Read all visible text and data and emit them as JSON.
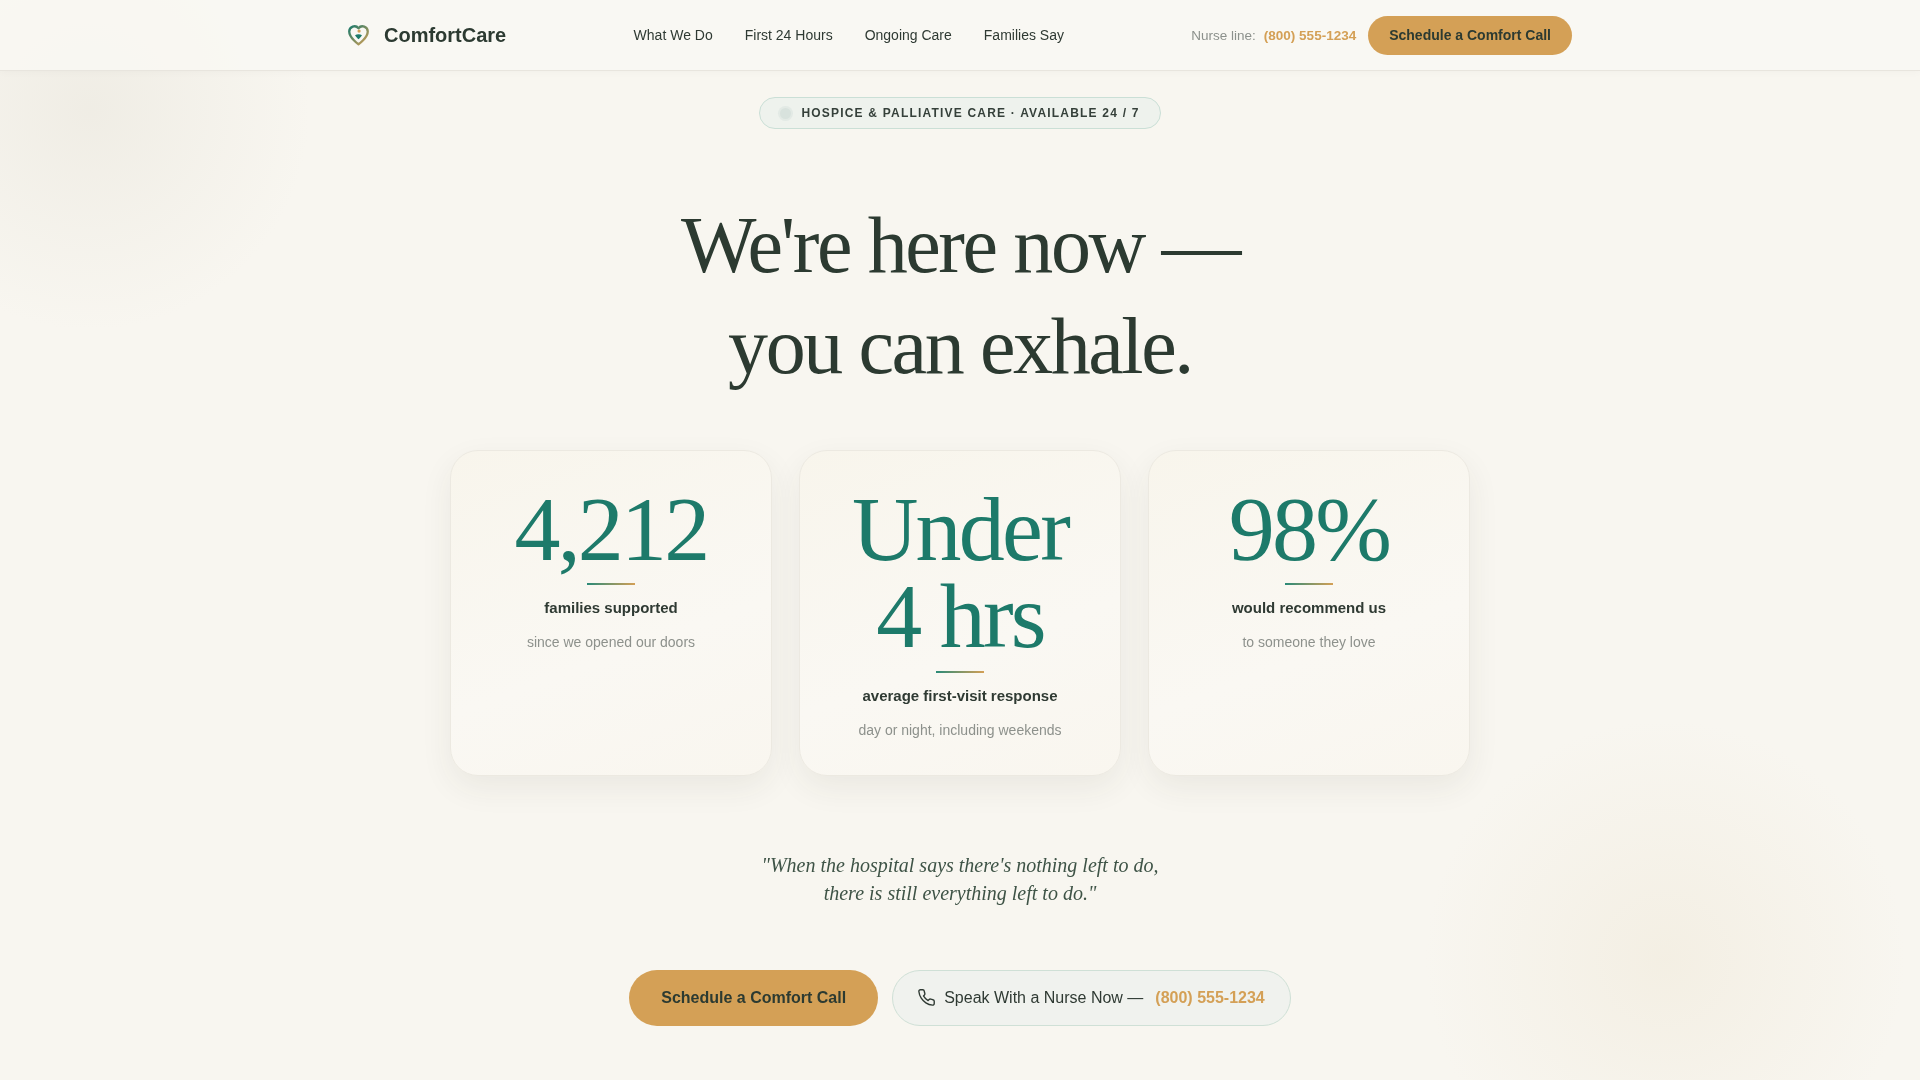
{
  "header": {
    "brand": "ComfortCare",
    "nav": [
      "What We Do",
      "First 24 Hours",
      "Ongoing Care",
      "Families Say"
    ],
    "nurse_line": {
      "label": "Nurse line:",
      "phone": "(800) 555-1234"
    },
    "button": "Schedule a Comfort Call"
  },
  "badge": "HOSPICE & PALLIATIVE CARE · AVAILABLE 24 / 7",
  "headline": "We're here now — you can exhale.",
  "stats": [
    {
      "figure": "4,212",
      "caption": "families supported",
      "note": "since we opened our doors"
    },
    {
      "figure": "Under 4 hrs",
      "caption": "average first-visit response",
      "note": "day or night, including weekends"
    },
    {
      "figure": "98%",
      "caption": "would recommend us",
      "note": "to someone they love"
    }
  ],
  "quote": "\"When the hospital says there's nothing left to do, there is still everything left to do.\"",
  "actions": {
    "primary": "Schedule a Comfort Call",
    "secondary": {
      "label": "Speak With a Nurse Now —",
      "phone": "(800) 555-1234"
    }
  }
}
